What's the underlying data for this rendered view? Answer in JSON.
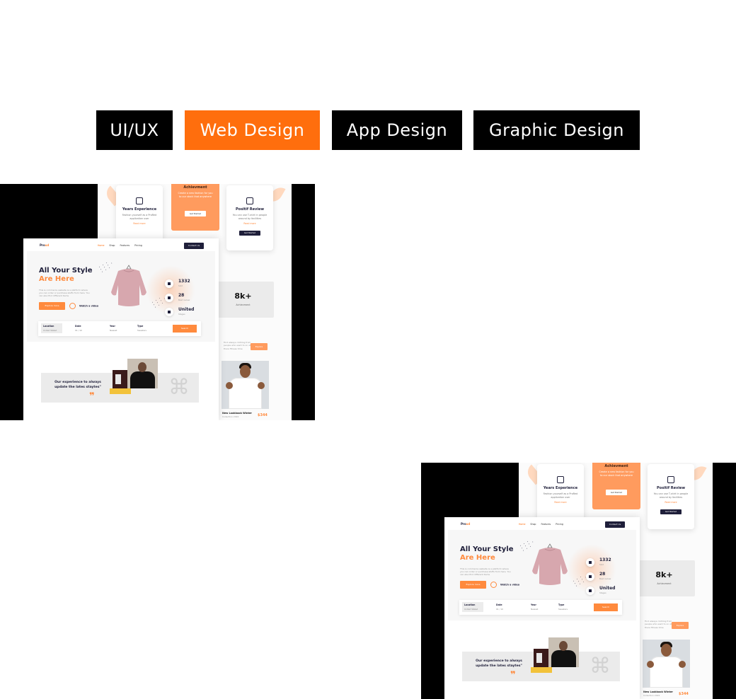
{
  "tabs": [
    {
      "label": "UI/UX",
      "active": false
    },
    {
      "label": "Web Design",
      "active": true
    },
    {
      "label": "App Design",
      "active": false
    },
    {
      "label": "Graphic Design",
      "active": false
    }
  ],
  "colors": {
    "accent": "#ff6e0d",
    "tab_bg": "#000000",
    "tab_text": "#ffffff"
  },
  "mockup": {
    "logo": {
      "prefix": "Pro",
      "suffix": "ud"
    },
    "nav": [
      "Home",
      "Shop",
      "Features",
      "Pricing"
    ],
    "contact_label": "Contact Us",
    "hero_title_1": "All Your Style",
    "hero_title_2": "Are Here",
    "hero_desc": "This is commerce website is a platform where you can order or purchase stuffs from here. You can also find different items",
    "explore_label": "Explore more",
    "watch_label": "Watch a video",
    "stats": [
      {
        "value": "1332",
        "label": "Sold",
        "icon": "card-icon"
      },
      {
        "value": "28",
        "label": "Best review",
        "icon": "users-icon"
      },
      {
        "value": "United",
        "label": "Stages",
        "icon": "chart-icon"
      }
    ],
    "search": {
      "location_label": "Location",
      "location_value": "United Stated",
      "date_label": "Date",
      "date_value": "01 / 10",
      "year_label": "Year",
      "year_value": "Newest",
      "type_label": "Type",
      "type_value": "Sweaters",
      "button": "Search"
    },
    "quote": "Our experience to always update the lates staytes\"",
    "experience": {
      "title": "Years Experience",
      "desc": "Fashion yourself as a ProRed application user",
      "link": "Read more"
    },
    "achievement": {
      "title": "Achievment",
      "desc": "Create a new fashion for you to our stock that anywhere",
      "button": "Get Started"
    },
    "review": {
      "title": "Positif Review",
      "desc": "You can use T-shirt in people around by facilities",
      "link": "Read more",
      "button": "Get Started"
    },
    "big_stat": {
      "value": "8k+",
      "label": "Achievment"
    },
    "feature_text": "Find always clothing from people who want to on stock there fitness time",
    "feature_button": "Explore",
    "product": {
      "name": "New Lookbook Winter",
      "sub": "Collection 2022",
      "price": "$344"
    }
  }
}
